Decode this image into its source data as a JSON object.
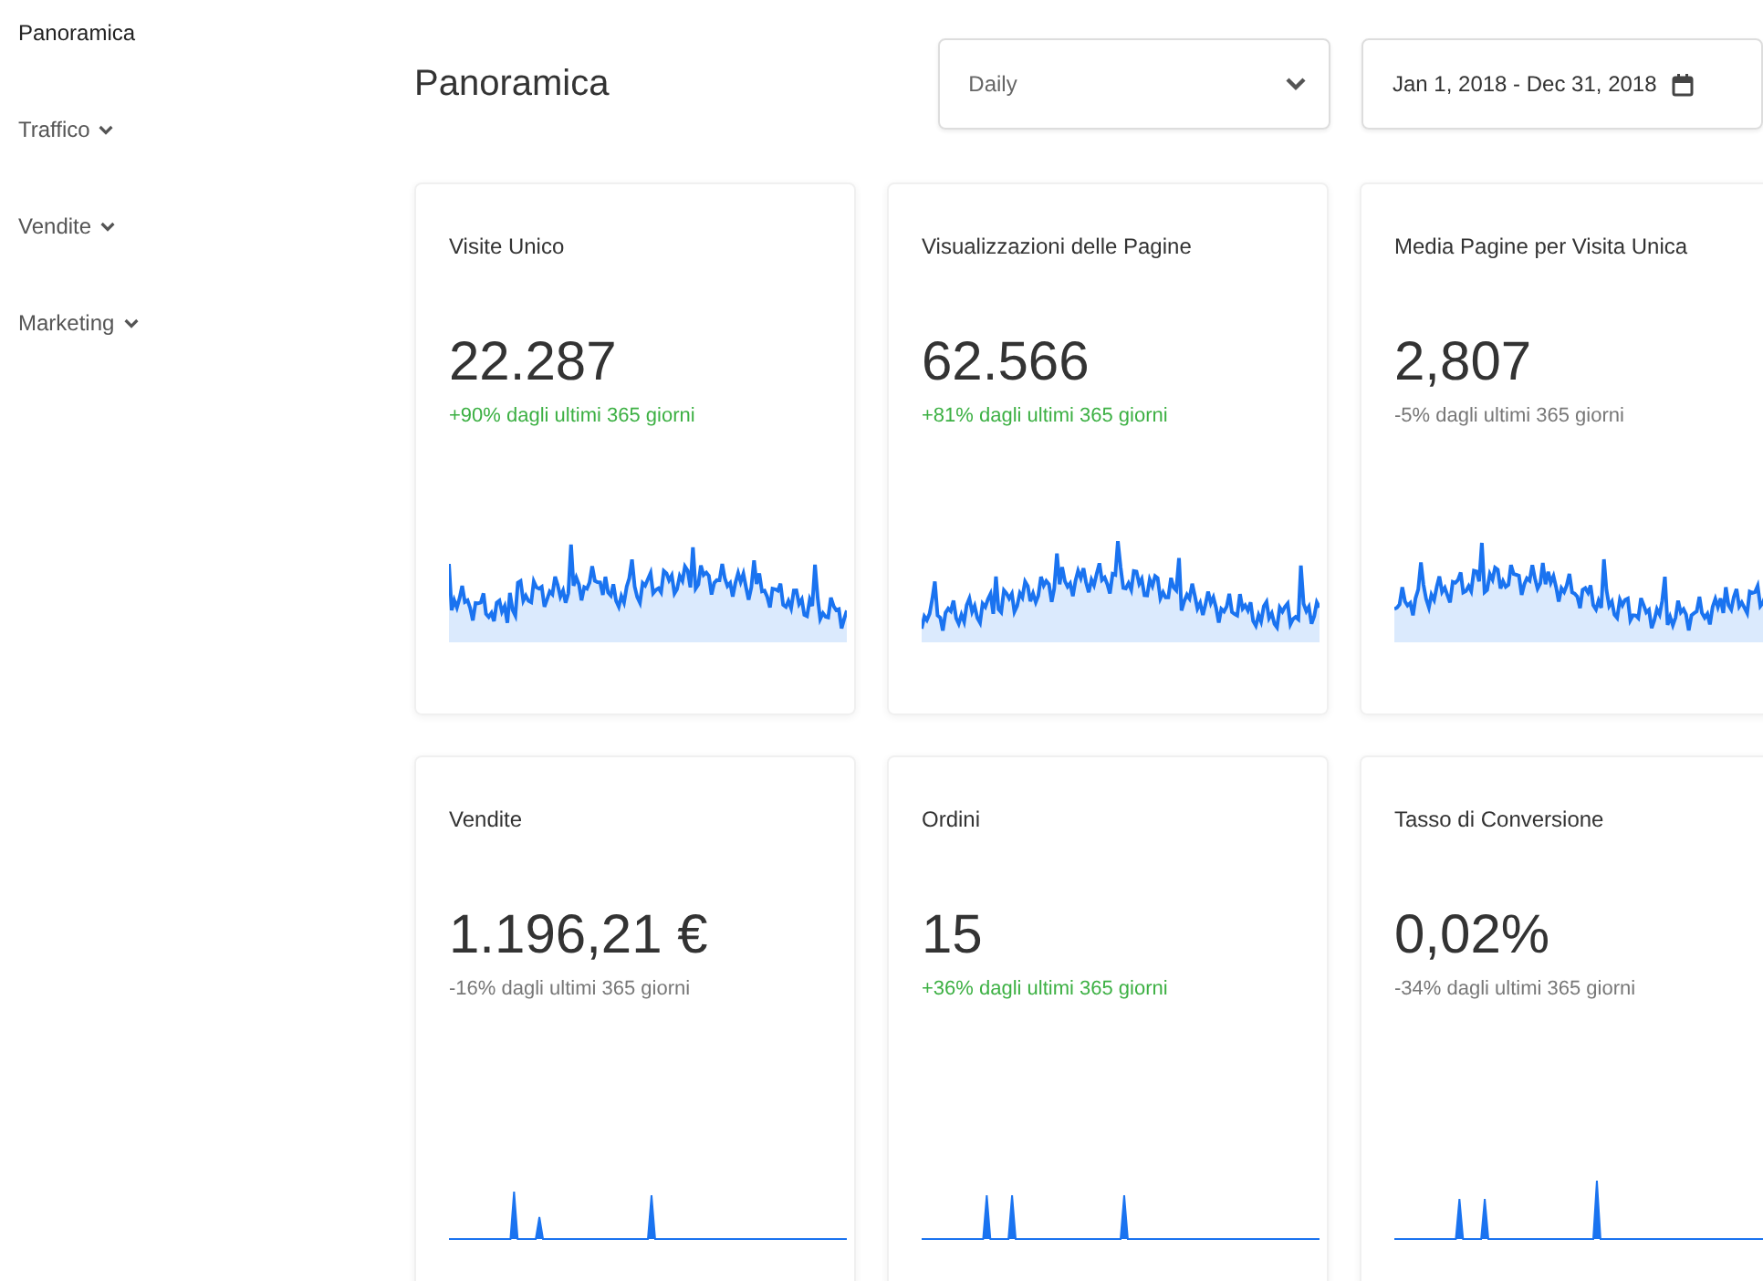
{
  "sidebar": {
    "items": [
      {
        "label": "Panoramica",
        "selected": true,
        "expandable": false
      },
      {
        "label": "Traffico",
        "selected": false,
        "expandable": true
      },
      {
        "label": "Vendite",
        "selected": false,
        "expandable": true
      },
      {
        "label": "Marketing",
        "selected": false,
        "expandable": true
      }
    ]
  },
  "header": {
    "title": "Panoramica",
    "interval": {
      "value": "Daily"
    },
    "date_range": {
      "value": "Jan 1, 2018 - Dec 31, 2018"
    }
  },
  "cards": [
    {
      "title": "Visite Unico",
      "value": "22.287",
      "change": "+90% dagli ultimi 365 giorni",
      "positive": true,
      "kind": "wave"
    },
    {
      "title": "Visualizzazioni delle Pagine",
      "value": "62.566",
      "change": "+81% dagli ultimi 365 giorni",
      "positive": true,
      "kind": "wave"
    },
    {
      "title": "Media Pagine per Visita Unica",
      "value": "2,807",
      "change": "-5% dagli ultimi 365 giorni",
      "positive": false,
      "kind": "wave"
    },
    {
      "title": "Vendite",
      "value": "1.196,21 €",
      "change": "-16% dagli ultimi 365 giorni",
      "positive": false,
      "kind": "spikes"
    },
    {
      "title": "Ordini",
      "value": "15",
      "change": "+36% dagli ultimi 365 giorni",
      "positive": true,
      "kind": "spikes"
    },
    {
      "title": "Tasso di Conversione",
      "value": "0,02%",
      "change": "-34% dagli ultimi 365 giorni",
      "positive": false,
      "kind": "spikes"
    }
  ]
}
